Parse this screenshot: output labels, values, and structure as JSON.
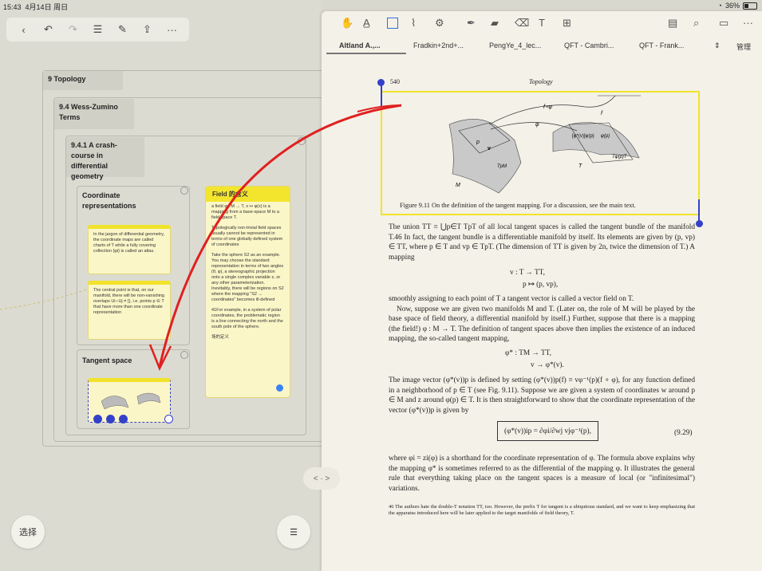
{
  "status": {
    "time": "15:43",
    "date": "4月14日 周日",
    "battery": "36%",
    "battery_fraction": 0.36
  },
  "left_toolbar": {
    "icons": [
      "back-icon",
      "undo-icon",
      "redo-icon",
      "list-icon",
      "edit-icon",
      "share-icon",
      "more-icon"
    ]
  },
  "mindmap": {
    "topology": "9 Topology",
    "wess": "9.4 Wess-Zumino Terms",
    "crash": "9.4.1 A crash-course in differential geometry",
    "coord": "Coordinate representations",
    "tangent": "Tangent space",
    "card1": "In the jargon of differential geometry, the coordinate maps are called charts of T while a fully covering collection {φi} is called an atlas.",
    "card2": "The central point is that, on our manifold, there will be non-vanishing overlaps Ui∩Uj ≠ {}, i.e. points p ∈ T that have more than one coordinate representation",
    "field_title": "Field 的含义",
    "field_p1": "a field φ : M → T, x ↦ φ(x) is a mapping from a base-space M to a field space T.",
    "field_p2": "Topologically non-trivial field spaces usually cannot be represented in terms of one globally defined system of coordinates",
    "field_p3": "Take the sphere S2 as an example. You may choose the standard representation in terms of two angles (θ, φ), a stereographic projection onto a single complex variable z, or any other parameterization. Inevitably, there will be regions on S2 where the mapping \"S2 → coordinates\" becomes ill-defined",
    "field_p4": "41For example, in a system of polar coordinates, the problematic region is a line connecting the north and the south pole of the sphere.",
    "field_footer": "场的定义"
  },
  "buttons": {
    "select": "选择",
    "menu_icon": "hamburger-icon",
    "nav": "< · >"
  },
  "right_toolbar": {
    "manage": "管理"
  },
  "tabs": [
    "Altland A.,...",
    "Fradkin+2nd+...",
    "PengYe_4_lec...",
    "QFT - Cambri...",
    "QFT - Frank..."
  ],
  "doc": {
    "page_no": "540",
    "header": "Topology",
    "caption": "Figure 9.11 On the definition of the tangent mapping. For a discussion, see the main text.",
    "para1": "The union TT ≡ ⋃p∈T TpT of all local tangent spaces is called the tangent bundle of the manifold T.46 In fact, the tangent bundle is a differentiable manifold by itself. Its elements are given by (p, vp) ∈ TT, where p ∈ T and vp ∈ TpT. (The dimension of TT is given by 2n, twice the dimension of T.) A mapping",
    "eq1a": "v : T → TT,",
    "eq1b": "p ↦ (p, vp),",
    "para2": "smoothly assigning to each point of T a tangent vector is called a vector field on T.",
    "para3": "Now, suppose we are given two manifolds M and T. (Later on, the role of M will be played by the base space of field theory, a differential manifold by itself.) Further, suppose that there is a mapping (the field!) φ : M → T. The definition of tangent spaces above then implies the existence of an induced mapping, the so-called tangent mapping,",
    "eq2a": "φ* : TM → TT,",
    "eq2b": "v → φ*(v).",
    "para4": "The image vector (φ*(v))p is defined by setting (φ*(v))p(f) ≡ vφ⁻¹(p)(f ∘ φ), for any function defined in a neighborhood of p ∈ T (see Fig. 9.11). Suppose we are given a system of coordinates w around p ∈ M and z around φ(p) ∈ T. It is then straightforward to show that the coordinate representation of the vector (φ*(v))p is given by",
    "eq3": "(φ*(v))ip = ∂φi/∂wj vjφ⁻¹(p),",
    "eq3_no": "(9.29)",
    "para5": "where φi = zi(φ) is a shorthand for the coordinate representation of φ. The formula above explains why the mapping φ* is sometimes referred to as the differential of the mapping φ. It illustrates the general rule that everything taking place on the tangent spaces is a measure of local (or \"infinitesimal\") variations.",
    "footnote": "46 The authors hate the double-T notation TT, too. However, the prefix T for tangent is a ubiquitous standard, and we want to keep emphasizing that the apparatus introduced here will be later applied to the target manifolds of field theory, T.",
    "fig_labels": [
      "f∘φ",
      "f",
      "φ",
      "p",
      "v",
      "TpM",
      "M",
      "[φ*(v)]φ(p)",
      "φ(p)",
      "Tφ(p)T",
      "T"
    ]
  }
}
